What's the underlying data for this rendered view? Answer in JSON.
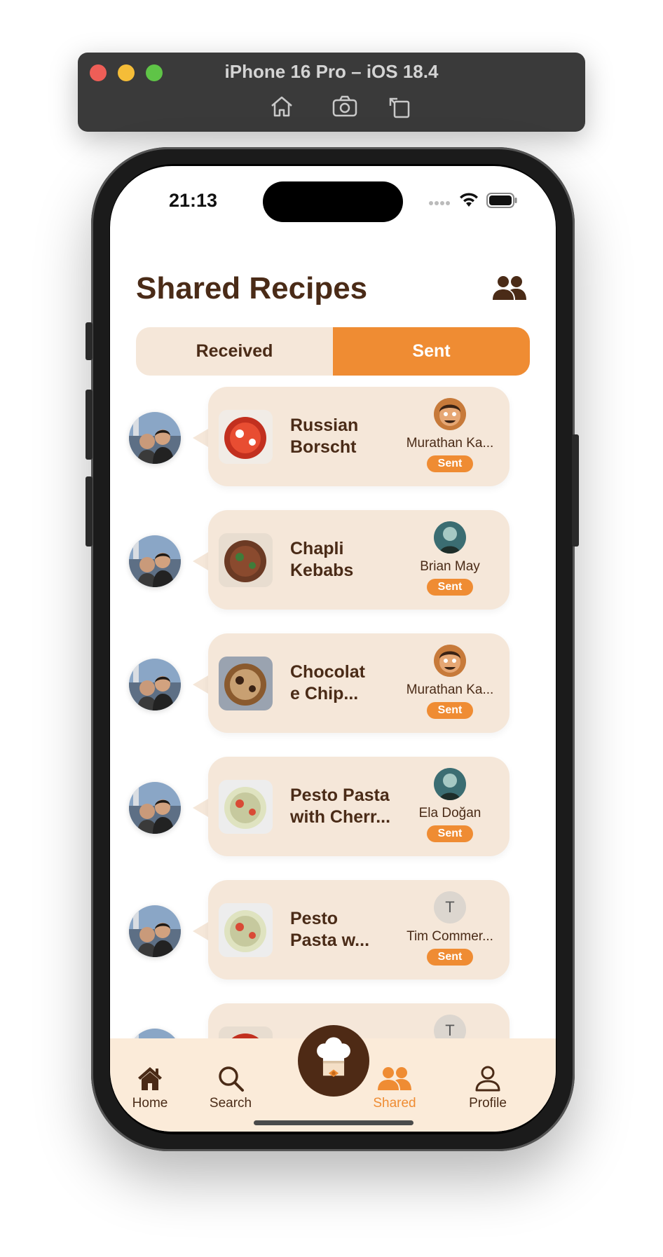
{
  "simulator": {
    "title": "iPhone 16 Pro – iOS 18.4"
  },
  "status_bar": {
    "time": "21:13"
  },
  "header": {
    "title": "Shared Recipes"
  },
  "segmented": {
    "received_label": "Received",
    "sent_label": "Sent",
    "selected": "Sent"
  },
  "recipes": [
    {
      "name": "Russian Borscht",
      "display_name": "Russian\nBorscht",
      "recipient": "Murathan Ka...",
      "recipient_avatar": "cartoon-avatar",
      "status": "Sent"
    },
    {
      "name": "Chapli Kebabs",
      "display_name": "Chapli\nKebabs",
      "recipient": "Brian May",
      "recipient_avatar": "photo-avatar",
      "status": "Sent"
    },
    {
      "name": "Chocolate Chip...",
      "display_name": "Chocolat\ne Chip...",
      "recipient": "Murathan Ka...",
      "recipient_avatar": "cartoon-avatar",
      "status": "Sent"
    },
    {
      "name": "Pesto Pasta with Cherr...",
      "display_name": "Pesto Pasta\nwith Cherr...",
      "recipient": "Ela Doğan",
      "recipient_avatar": "photo-avatar",
      "status": "Sent"
    },
    {
      "name": "Pesto Pasta w...",
      "display_name": "Pesto\nPasta w...",
      "recipient": "Tim Commer...",
      "recipient_avatar": "T",
      "status": "Sent"
    },
    {
      "name": "",
      "display_name": "",
      "recipient": "",
      "recipient_avatar": "T",
      "status": ""
    }
  ],
  "tabbar": {
    "home": "Home",
    "search": "Search",
    "shared": "Shared",
    "profile": "Profile",
    "active": "Shared"
  },
  "colors": {
    "accent": "#ef8c33",
    "brown": "#4a2b17",
    "bubble": "#f5e7d9",
    "tabbar": "#fbebd9"
  }
}
